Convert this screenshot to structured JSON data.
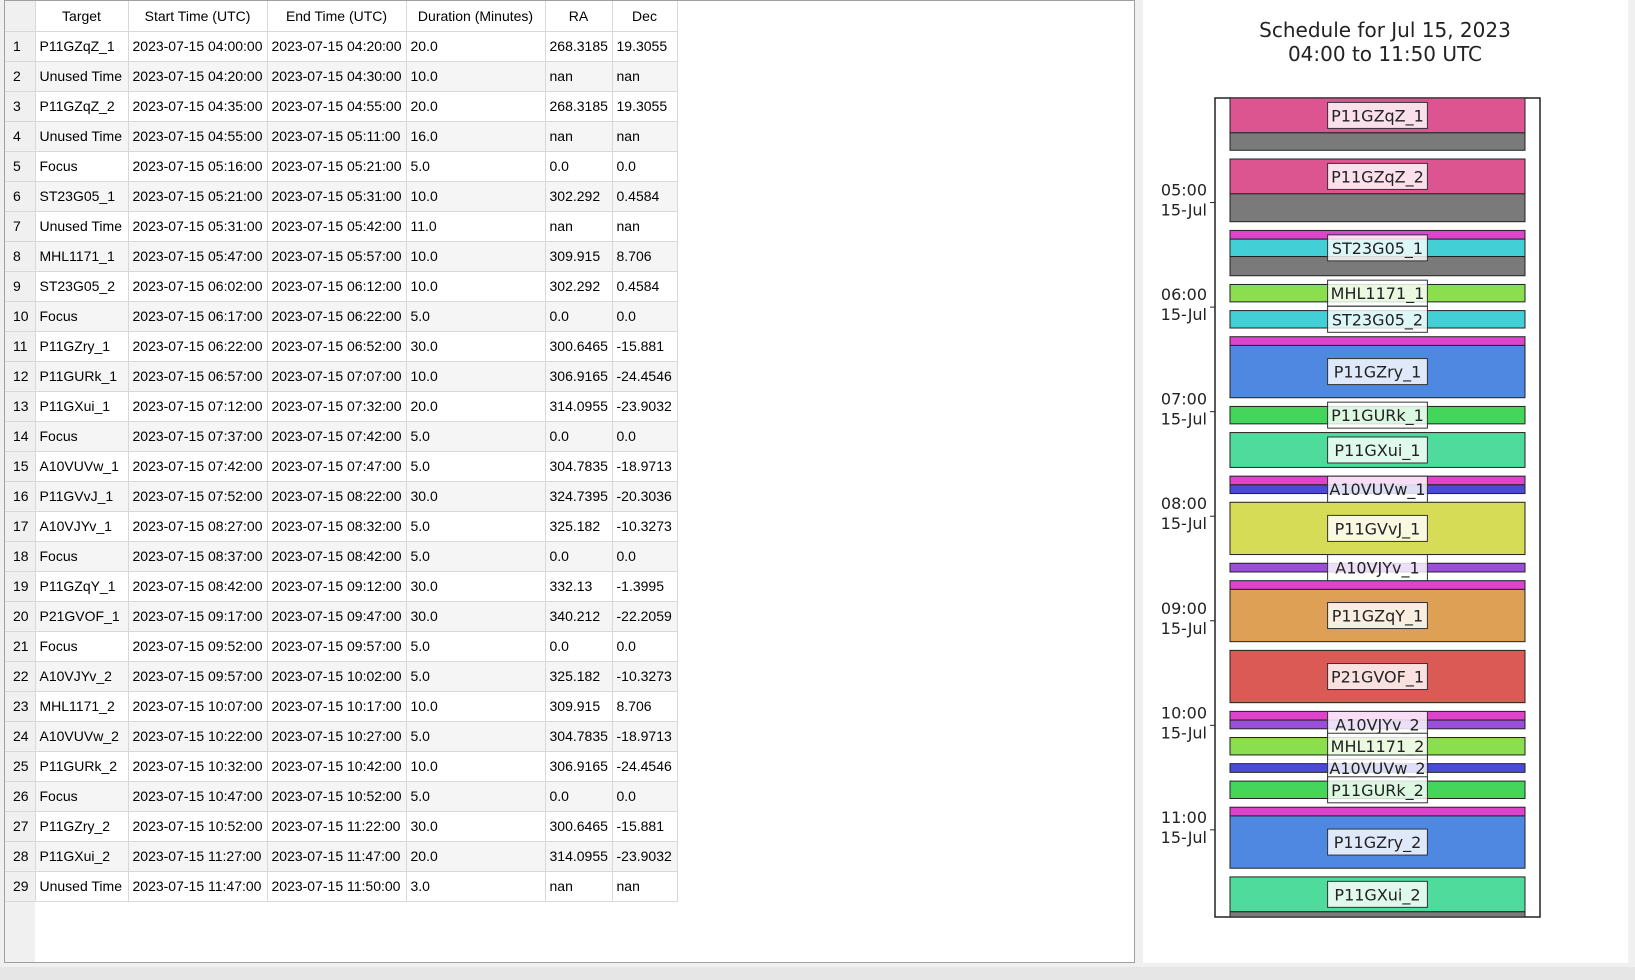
{
  "table": {
    "columns": [
      "Target",
      "Start Time (UTC)",
      "End Time (UTC)",
      "Duration (Minutes)",
      "RA",
      "Dec"
    ],
    "rows": [
      {
        "idx": "1",
        "target": "P11GZqZ_1",
        "start": "2023-07-15 04:00:00",
        "end": "2023-07-15 04:20:00",
        "duration": "20.0",
        "ra": "268.3185",
        "dec": "19.3055"
      },
      {
        "idx": "2",
        "target": "Unused Time",
        "start": "2023-07-15 04:20:00",
        "end": "2023-07-15 04:30:00",
        "duration": "10.0",
        "ra": "nan",
        "dec": "nan"
      },
      {
        "idx": "3",
        "target": "P11GZqZ_2",
        "start": "2023-07-15 04:35:00",
        "end": "2023-07-15 04:55:00",
        "duration": "20.0",
        "ra": "268.3185",
        "dec": "19.3055"
      },
      {
        "idx": "4",
        "target": "Unused Time",
        "start": "2023-07-15 04:55:00",
        "end": "2023-07-15 05:11:00",
        "duration": "16.0",
        "ra": "nan",
        "dec": "nan"
      },
      {
        "idx": "5",
        "target": "Focus",
        "start": "2023-07-15 05:16:00",
        "end": "2023-07-15 05:21:00",
        "duration": "5.0",
        "ra": "0.0",
        "dec": "0.0"
      },
      {
        "idx": "6",
        "target": "ST23G05_1",
        "start": "2023-07-15 05:21:00",
        "end": "2023-07-15 05:31:00",
        "duration": "10.0",
        "ra": "302.292",
        "dec": "0.4584"
      },
      {
        "idx": "7",
        "target": "Unused Time",
        "start": "2023-07-15 05:31:00",
        "end": "2023-07-15 05:42:00",
        "duration": "11.0",
        "ra": "nan",
        "dec": "nan"
      },
      {
        "idx": "8",
        "target": "MHL1171_1",
        "start": "2023-07-15 05:47:00",
        "end": "2023-07-15 05:57:00",
        "duration": "10.0",
        "ra": "309.915",
        "dec": "8.706"
      },
      {
        "idx": "9",
        "target": "ST23G05_2",
        "start": "2023-07-15 06:02:00",
        "end": "2023-07-15 06:12:00",
        "duration": "10.0",
        "ra": "302.292",
        "dec": "0.4584"
      },
      {
        "idx": "10",
        "target": "Focus",
        "start": "2023-07-15 06:17:00",
        "end": "2023-07-15 06:22:00",
        "duration": "5.0",
        "ra": "0.0",
        "dec": "0.0"
      },
      {
        "idx": "11",
        "target": "P11GZry_1",
        "start": "2023-07-15 06:22:00",
        "end": "2023-07-15 06:52:00",
        "duration": "30.0",
        "ra": "300.6465",
        "dec": "-15.881"
      },
      {
        "idx": "12",
        "target": "P11GURk_1",
        "start": "2023-07-15 06:57:00",
        "end": "2023-07-15 07:07:00",
        "duration": "10.0",
        "ra": "306.9165",
        "dec": "-24.4546"
      },
      {
        "idx": "13",
        "target": "P11GXui_1",
        "start": "2023-07-15 07:12:00",
        "end": "2023-07-15 07:32:00",
        "duration": "20.0",
        "ra": "314.0955",
        "dec": "-23.9032"
      },
      {
        "idx": "14",
        "target": "Focus",
        "start": "2023-07-15 07:37:00",
        "end": "2023-07-15 07:42:00",
        "duration": "5.0",
        "ra": "0.0",
        "dec": "0.0"
      },
      {
        "idx": "15",
        "target": "A10VUVw_1",
        "start": "2023-07-15 07:42:00",
        "end": "2023-07-15 07:47:00",
        "duration": "5.0",
        "ra": "304.7835",
        "dec": "-18.9713"
      },
      {
        "idx": "16",
        "target": "P11GVvJ_1",
        "start": "2023-07-15 07:52:00",
        "end": "2023-07-15 08:22:00",
        "duration": "30.0",
        "ra": "324.7395",
        "dec": "-20.3036"
      },
      {
        "idx": "17",
        "target": "A10VJYv_1",
        "start": "2023-07-15 08:27:00",
        "end": "2023-07-15 08:32:00",
        "duration": "5.0",
        "ra": "325.182",
        "dec": "-10.3273"
      },
      {
        "idx": "18",
        "target": "Focus",
        "start": "2023-07-15 08:37:00",
        "end": "2023-07-15 08:42:00",
        "duration": "5.0",
        "ra": "0.0",
        "dec": "0.0"
      },
      {
        "idx": "19",
        "target": "P11GZqY_1",
        "start": "2023-07-15 08:42:00",
        "end": "2023-07-15 09:12:00",
        "duration": "30.0",
        "ra": "332.13",
        "dec": "-1.3995"
      },
      {
        "idx": "20",
        "target": "P21GVOF_1",
        "start": "2023-07-15 09:17:00",
        "end": "2023-07-15 09:47:00",
        "duration": "30.0",
        "ra": "340.212",
        "dec": "-22.2059"
      },
      {
        "idx": "21",
        "target": "Focus",
        "start": "2023-07-15 09:52:00",
        "end": "2023-07-15 09:57:00",
        "duration": "5.0",
        "ra": "0.0",
        "dec": "0.0"
      },
      {
        "idx": "22",
        "target": "A10VJYv_2",
        "start": "2023-07-15 09:57:00",
        "end": "2023-07-15 10:02:00",
        "duration": "5.0",
        "ra": "325.182",
        "dec": "-10.3273"
      },
      {
        "idx": "23",
        "target": "MHL1171_2",
        "start": "2023-07-15 10:07:00",
        "end": "2023-07-15 10:17:00",
        "duration": "10.0",
        "ra": "309.915",
        "dec": "8.706"
      },
      {
        "idx": "24",
        "target": "A10VUVw_2",
        "start": "2023-07-15 10:22:00",
        "end": "2023-07-15 10:27:00",
        "duration": "5.0",
        "ra": "304.7835",
        "dec": "-18.9713"
      },
      {
        "idx": "25",
        "target": "P11GURk_2",
        "start": "2023-07-15 10:32:00",
        "end": "2023-07-15 10:42:00",
        "duration": "10.0",
        "ra": "306.9165",
        "dec": "-24.4546"
      },
      {
        "idx": "26",
        "target": "Focus",
        "start": "2023-07-15 10:47:00",
        "end": "2023-07-15 10:52:00",
        "duration": "5.0",
        "ra": "0.0",
        "dec": "0.0"
      },
      {
        "idx": "27",
        "target": "P11GZry_2",
        "start": "2023-07-15 10:52:00",
        "end": "2023-07-15 11:22:00",
        "duration": "30.0",
        "ra": "300.6465",
        "dec": "-15.881"
      },
      {
        "idx": "28",
        "target": "P11GXui_2",
        "start": "2023-07-15 11:27:00",
        "end": "2023-07-15 11:47:00",
        "duration": "20.0",
        "ra": "314.0955",
        "dec": "-23.9032"
      },
      {
        "idx": "29",
        "target": "Unused Time",
        "start": "2023-07-15 11:47:00",
        "end": "2023-07-15 11:50:00",
        "duration": "3.0",
        "ra": "nan",
        "dec": "nan"
      }
    ]
  },
  "chart_data": {
    "type": "timeline",
    "title": "Schedule for Jul 15, 2023",
    "subtitle": "04:00 to 11:50 UTC",
    "time_range": [
      "04:00",
      "11:50"
    ],
    "y_ticks": [
      {
        "time": "05:00",
        "date": "15-Jul"
      },
      {
        "time": "06:00",
        "date": "15-Jul"
      },
      {
        "time": "07:00",
        "date": "15-Jul"
      },
      {
        "time": "08:00",
        "date": "15-Jul"
      },
      {
        "time": "09:00",
        "date": "15-Jul"
      },
      {
        "time": "10:00",
        "date": "15-Jul"
      },
      {
        "time": "11:00",
        "date": "15-Jul"
      }
    ],
    "blocks": [
      {
        "label": "P11GZqZ_1",
        "start": "04:00",
        "end": "04:20",
        "color": "#dc5591"
      },
      {
        "label": "",
        "start": "04:20",
        "end": "04:30",
        "color": "#7a7a7a"
      },
      {
        "label": "P11GZqZ_2",
        "start": "04:35",
        "end": "04:55",
        "color": "#dc5591"
      },
      {
        "label": "",
        "start": "04:55",
        "end": "05:11",
        "color": "#7a7a7a"
      },
      {
        "label": "",
        "start": "05:16",
        "end": "05:21",
        "color": "#dd44cc"
      },
      {
        "label": "ST23G05_1",
        "start": "05:21",
        "end": "05:31",
        "color": "#43cfd6"
      },
      {
        "label": "",
        "start": "05:31",
        "end": "05:42",
        "color": "#7a7a7a"
      },
      {
        "label": "MHL1171_1",
        "start": "05:47",
        "end": "05:57",
        "color": "#8bde4e"
      },
      {
        "label": "ST23G05_2",
        "start": "06:02",
        "end": "06:12",
        "color": "#43cfd6"
      },
      {
        "label": "",
        "start": "06:17",
        "end": "06:22",
        "color": "#dd44cc"
      },
      {
        "label": "P11GZry_1",
        "start": "06:22",
        "end": "06:52",
        "color": "#4e88e0"
      },
      {
        "label": "P11GURk_1",
        "start": "06:57",
        "end": "07:07",
        "color": "#44d65a"
      },
      {
        "label": "P11GXui_1",
        "start": "07:12",
        "end": "07:32",
        "color": "#4fdb9b"
      },
      {
        "label": "",
        "start": "07:37",
        "end": "07:42",
        "color": "#dd44cc"
      },
      {
        "label": "A10VUVw_1",
        "start": "07:42",
        "end": "07:47",
        "color": "#4a4ad8"
      },
      {
        "label": "P11GVvJ_1",
        "start": "07:52",
        "end": "08:22",
        "color": "#d6dc55"
      },
      {
        "label": "A10VJYv_1",
        "start": "08:27",
        "end": "08:32",
        "color": "#9b4edc"
      },
      {
        "label": "",
        "start": "08:37",
        "end": "08:42",
        "color": "#dd44cc"
      },
      {
        "label": "P11GZqY_1",
        "start": "08:42",
        "end": "09:12",
        "color": "#dea054"
      },
      {
        "label": "P21GVOF_1",
        "start": "09:17",
        "end": "09:47",
        "color": "#dc5a55"
      },
      {
        "label": "",
        "start": "09:52",
        "end": "09:57",
        "color": "#dd44cc"
      },
      {
        "label": "A10VJYv_2",
        "start": "09:57",
        "end": "10:02",
        "color": "#9b4edc"
      },
      {
        "label": "MHL1171_2",
        "start": "10:07",
        "end": "10:17",
        "color": "#8bde4e"
      },
      {
        "label": "A10VUVw_2",
        "start": "10:22",
        "end": "10:27",
        "color": "#4a4ad8"
      },
      {
        "label": "P11GURk_2",
        "start": "10:32",
        "end": "10:42",
        "color": "#44d65a"
      },
      {
        "label": "",
        "start": "10:47",
        "end": "10:52",
        "color": "#dd44cc"
      },
      {
        "label": "P11GZry_2",
        "start": "10:52",
        "end": "11:22",
        "color": "#4e88e0"
      },
      {
        "label": "P11GXui_2",
        "start": "11:27",
        "end": "11:47",
        "color": "#4fdb9b"
      },
      {
        "label": "",
        "start": "11:47",
        "end": "11:50",
        "color": "#7a7a7a"
      }
    ]
  }
}
